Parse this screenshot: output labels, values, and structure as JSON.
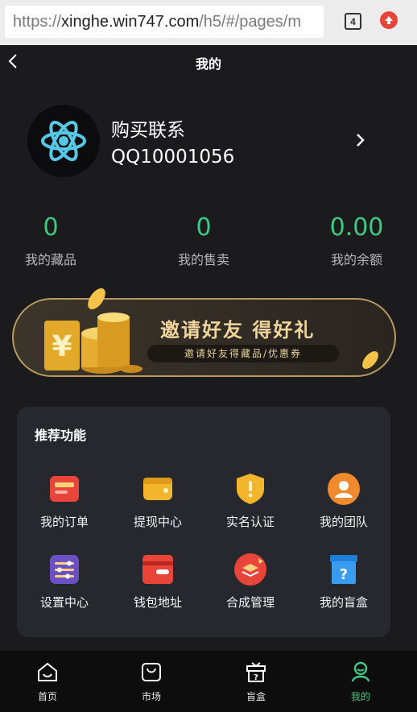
{
  "browser": {
    "url_prefix": "https://",
    "url_host": "xinghe.win747.com",
    "url_path": "/h5/#/pages/m",
    "tab_count": "4"
  },
  "header": {
    "title": "我的"
  },
  "profile": {
    "name": "购买联系",
    "qq": "QQ10001056"
  },
  "stats": [
    {
      "value": "0",
      "label": "我的藏品"
    },
    {
      "value": "0",
      "label": "我的售卖"
    },
    {
      "value": "0.00",
      "label": "我的余额"
    }
  ],
  "banner": {
    "title": "邀请好友  得好礼",
    "subtitle": "邀请好友得藏品/优惠券"
  },
  "features": {
    "title": "推荐功能",
    "items": [
      {
        "label": "我的订单",
        "icon": "order-icon"
      },
      {
        "label": "提现中心",
        "icon": "wallet-icon"
      },
      {
        "label": "实名认证",
        "icon": "shield-icon"
      },
      {
        "label": "我的团队",
        "icon": "team-icon"
      },
      {
        "label": "设置中心",
        "icon": "settings-icon"
      },
      {
        "label": "钱包地址",
        "icon": "card-icon"
      },
      {
        "label": "合成管理",
        "icon": "synthesis-icon"
      },
      {
        "label": "我的盲盒",
        "icon": "blindbox-icon"
      }
    ]
  },
  "tabbar": [
    {
      "label": "首页",
      "icon": "home-icon"
    },
    {
      "label": "市场",
      "icon": "market-icon"
    },
    {
      "label": "盲盒",
      "icon": "gift-box-icon"
    },
    {
      "label": "我的",
      "icon": "profile-icon",
      "active": true
    }
  ],
  "colors": {
    "accent": "#3fca83",
    "background": "#1b1b1d",
    "panel": "#26282d",
    "banner_gold": "#f1d49b"
  }
}
